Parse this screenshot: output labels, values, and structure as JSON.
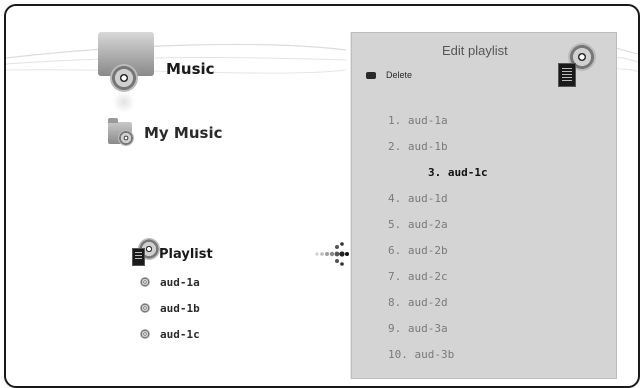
{
  "left_menu": {
    "music_label": "Music",
    "my_music_label": "My Music",
    "playlist": {
      "label": "Playlist",
      "items": [
        "aud-1a",
        "aud-1b",
        "aud-1c"
      ]
    }
  },
  "edit_panel": {
    "title": "Edit playlist",
    "delete_label": "Delete",
    "tracks": [
      "1. aud-1a",
      "2. aud-1b",
      "3. aud-1c",
      "4. aud-1d",
      "5. aud-2a",
      "6. aud-2b",
      "7. aud-2c",
      "8. aud-2d",
      "9. aud-3a",
      "10. aud-3b"
    ],
    "selected_index": 2
  },
  "icons": {
    "music": "music-disc-icon",
    "my_music": "music-folder-icon",
    "playlist": "playlist-icon",
    "track": "disc-icon",
    "edit_panel": "edit-playlist-icon",
    "connector": "dotted-arrow-icon",
    "delete_button": "delete-button-icon"
  },
  "colors": {
    "panel_bg": "#d4d4d4",
    "selected_text": "#111111",
    "track_text": "#7a7a7a"
  }
}
